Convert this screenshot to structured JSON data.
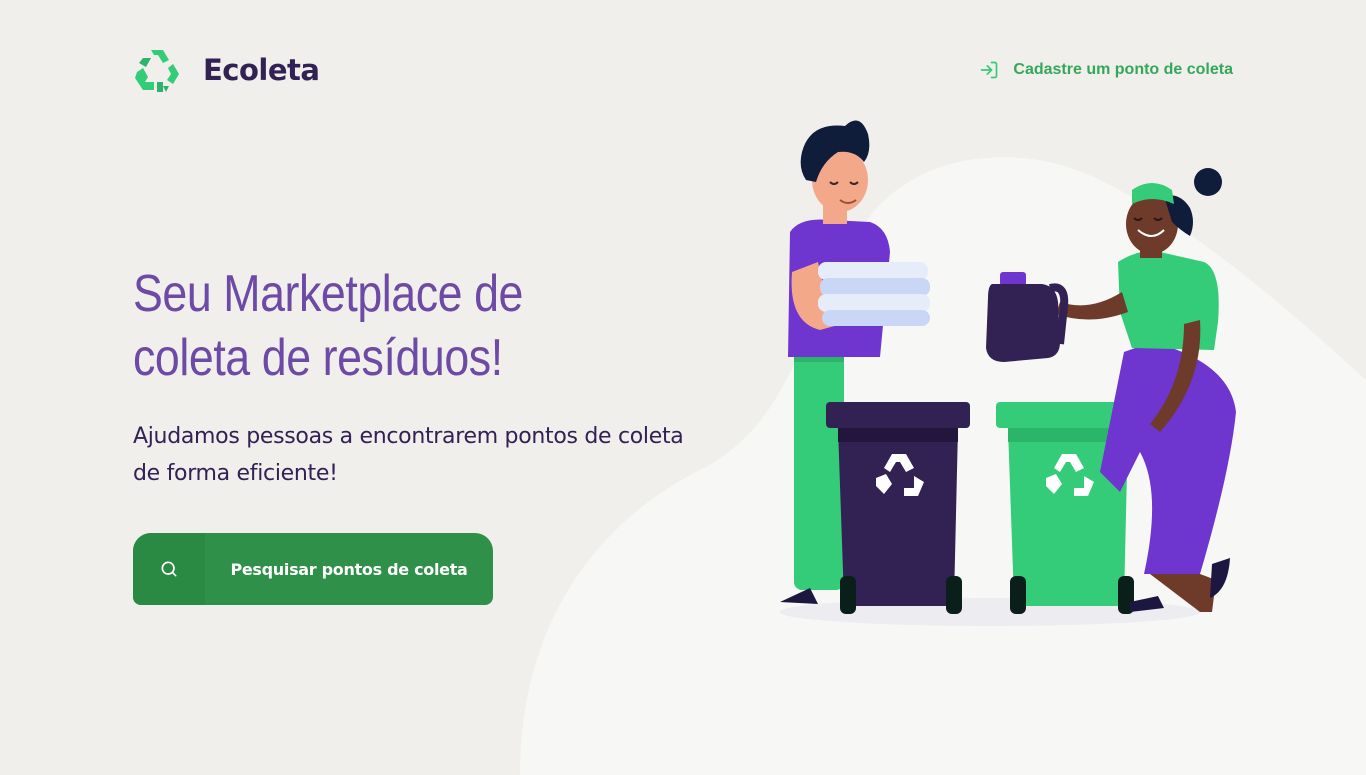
{
  "app": {
    "name": "Ecoleta"
  },
  "header": {
    "register_label": "Cadastre um ponto de coleta",
    "icons": {
      "logo": "recycle-icon",
      "register": "log-in-icon"
    }
  },
  "hero": {
    "title": "Seu Marketplace de coleta de resíduos!",
    "subtitle": "Ajudamos pessoas a encontrarem pontos de coleta de forma eficiente!",
    "cta_label": "Pesquisar pontos de coleta",
    "cta_icon": "search-icon"
  },
  "illustration": {
    "description_icons": [
      "recycle-icon",
      "recycle-icon"
    ]
  },
  "colors": {
    "background": "#F0EFEC",
    "title_purple": "#6C4AA5",
    "text_dark": "#322153",
    "brand_green": "#34CB79",
    "button_green": "#2F9149",
    "link_green": "#34A85A"
  }
}
